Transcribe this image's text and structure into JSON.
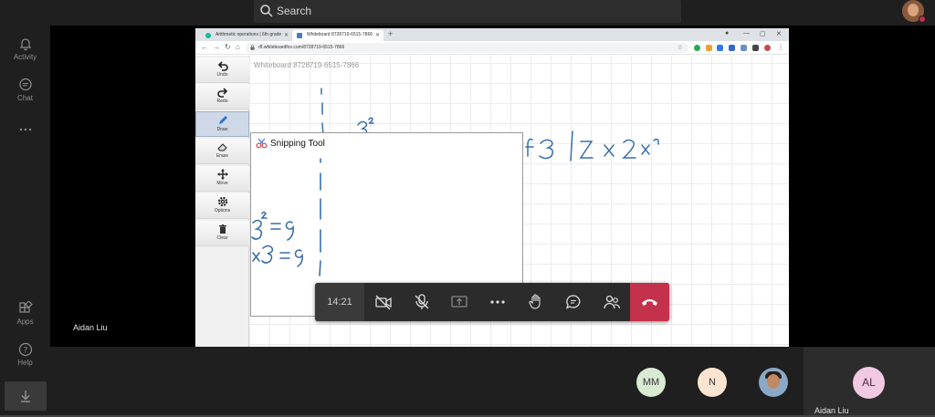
{
  "top_bar": {
    "search_placeholder": "Search"
  },
  "rail": {
    "items": [
      {
        "label": "Activity",
        "icon": "bell-icon"
      },
      {
        "label": "Chat",
        "icon": "chat-icon"
      },
      {
        "label": "",
        "icon": "more-icon"
      },
      {
        "label": "Apps",
        "icon": "apps-icon"
      },
      {
        "label": "Help",
        "icon": "help-icon"
      }
    ],
    "download_icon": "download-icon"
  },
  "presenter_name": "Aidan Liu",
  "browser": {
    "tabs": [
      {
        "title": "Arithmetic operations | 6th grade",
        "active": false
      },
      {
        "title": "Whiteboard 8728719-6515-7866",
        "active": true
      }
    ],
    "new_tab": "+",
    "url": "r8.whiteboardfox.com/8728719-6515-7866",
    "window_buttons": [
      "—",
      "▢",
      "✕"
    ]
  },
  "whiteboard": {
    "title": "Whiteboard 8728719-6515-7866",
    "tools": [
      {
        "label": "Undo",
        "icon": "undo-icon"
      },
      {
        "label": "Redo",
        "icon": "redo-icon"
      },
      {
        "label": "Draw",
        "icon": "pencil-icon",
        "active": true
      },
      {
        "label": "Erase",
        "icon": "eraser-icon"
      },
      {
        "label": "Move",
        "icon": "move-icon"
      },
      {
        "label": "Options",
        "icon": "gear-icon"
      },
      {
        "label": "Clear",
        "icon": "trash-icon"
      }
    ],
    "ink_color": "#3a6fa8"
  },
  "snipping_tool": {
    "title": "Snipping Tool"
  },
  "controls": {
    "timer": "14:21",
    "buttons": [
      "camera-off-icon",
      "mic-off-icon",
      "share-screen-icon",
      "more-icon",
      "raise-hand-icon",
      "chat-icon",
      "participants-icon",
      "hang-up-icon"
    ],
    "hangup_color": "#c4314b"
  },
  "participants": [
    {
      "initials": "MM",
      "color": "#d9ead3"
    },
    {
      "initials": "N",
      "color": "#fbe5d0"
    },
    {
      "initials": "",
      "photo": true
    }
  ],
  "self": {
    "initials": "AL",
    "name": "Aidan Liu"
  }
}
